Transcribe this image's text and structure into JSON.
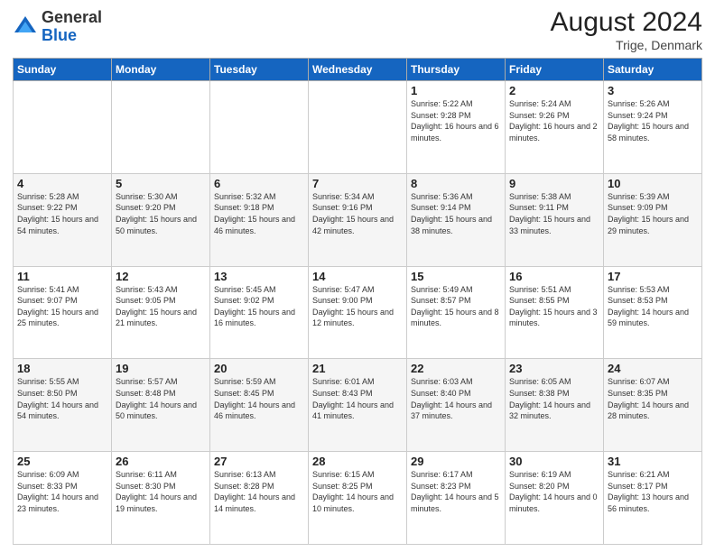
{
  "header": {
    "logo_general": "General",
    "logo_blue": "Blue",
    "month_year": "August 2024",
    "location": "Trige, Denmark"
  },
  "days_of_week": [
    "Sunday",
    "Monday",
    "Tuesday",
    "Wednesday",
    "Thursday",
    "Friday",
    "Saturday"
  ],
  "weeks": [
    [
      {
        "day": "",
        "info": ""
      },
      {
        "day": "",
        "info": ""
      },
      {
        "day": "",
        "info": ""
      },
      {
        "day": "",
        "info": ""
      },
      {
        "day": "1",
        "info": "Sunrise: 5:22 AM\nSunset: 9:28 PM\nDaylight: 16 hours\nand 6 minutes."
      },
      {
        "day": "2",
        "info": "Sunrise: 5:24 AM\nSunset: 9:26 PM\nDaylight: 16 hours\nand 2 minutes."
      },
      {
        "day": "3",
        "info": "Sunrise: 5:26 AM\nSunset: 9:24 PM\nDaylight: 15 hours\nand 58 minutes."
      }
    ],
    [
      {
        "day": "4",
        "info": "Sunrise: 5:28 AM\nSunset: 9:22 PM\nDaylight: 15 hours\nand 54 minutes."
      },
      {
        "day": "5",
        "info": "Sunrise: 5:30 AM\nSunset: 9:20 PM\nDaylight: 15 hours\nand 50 minutes."
      },
      {
        "day": "6",
        "info": "Sunrise: 5:32 AM\nSunset: 9:18 PM\nDaylight: 15 hours\nand 46 minutes."
      },
      {
        "day": "7",
        "info": "Sunrise: 5:34 AM\nSunset: 9:16 PM\nDaylight: 15 hours\nand 42 minutes."
      },
      {
        "day": "8",
        "info": "Sunrise: 5:36 AM\nSunset: 9:14 PM\nDaylight: 15 hours\nand 38 minutes."
      },
      {
        "day": "9",
        "info": "Sunrise: 5:38 AM\nSunset: 9:11 PM\nDaylight: 15 hours\nand 33 minutes."
      },
      {
        "day": "10",
        "info": "Sunrise: 5:39 AM\nSunset: 9:09 PM\nDaylight: 15 hours\nand 29 minutes."
      }
    ],
    [
      {
        "day": "11",
        "info": "Sunrise: 5:41 AM\nSunset: 9:07 PM\nDaylight: 15 hours\nand 25 minutes."
      },
      {
        "day": "12",
        "info": "Sunrise: 5:43 AM\nSunset: 9:05 PM\nDaylight: 15 hours\nand 21 minutes."
      },
      {
        "day": "13",
        "info": "Sunrise: 5:45 AM\nSunset: 9:02 PM\nDaylight: 15 hours\nand 16 minutes."
      },
      {
        "day": "14",
        "info": "Sunrise: 5:47 AM\nSunset: 9:00 PM\nDaylight: 15 hours\nand 12 minutes."
      },
      {
        "day": "15",
        "info": "Sunrise: 5:49 AM\nSunset: 8:57 PM\nDaylight: 15 hours\nand 8 minutes."
      },
      {
        "day": "16",
        "info": "Sunrise: 5:51 AM\nSunset: 8:55 PM\nDaylight: 15 hours\nand 3 minutes."
      },
      {
        "day": "17",
        "info": "Sunrise: 5:53 AM\nSunset: 8:53 PM\nDaylight: 14 hours\nand 59 minutes."
      }
    ],
    [
      {
        "day": "18",
        "info": "Sunrise: 5:55 AM\nSunset: 8:50 PM\nDaylight: 14 hours\nand 54 minutes."
      },
      {
        "day": "19",
        "info": "Sunrise: 5:57 AM\nSunset: 8:48 PM\nDaylight: 14 hours\nand 50 minutes."
      },
      {
        "day": "20",
        "info": "Sunrise: 5:59 AM\nSunset: 8:45 PM\nDaylight: 14 hours\nand 46 minutes."
      },
      {
        "day": "21",
        "info": "Sunrise: 6:01 AM\nSunset: 8:43 PM\nDaylight: 14 hours\nand 41 minutes."
      },
      {
        "day": "22",
        "info": "Sunrise: 6:03 AM\nSunset: 8:40 PM\nDaylight: 14 hours\nand 37 minutes."
      },
      {
        "day": "23",
        "info": "Sunrise: 6:05 AM\nSunset: 8:38 PM\nDaylight: 14 hours\nand 32 minutes."
      },
      {
        "day": "24",
        "info": "Sunrise: 6:07 AM\nSunset: 8:35 PM\nDaylight: 14 hours\nand 28 minutes."
      }
    ],
    [
      {
        "day": "25",
        "info": "Sunrise: 6:09 AM\nSunset: 8:33 PM\nDaylight: 14 hours\nand 23 minutes."
      },
      {
        "day": "26",
        "info": "Sunrise: 6:11 AM\nSunset: 8:30 PM\nDaylight: 14 hours\nand 19 minutes."
      },
      {
        "day": "27",
        "info": "Sunrise: 6:13 AM\nSunset: 8:28 PM\nDaylight: 14 hours\nand 14 minutes."
      },
      {
        "day": "28",
        "info": "Sunrise: 6:15 AM\nSunset: 8:25 PM\nDaylight: 14 hours\nand 10 minutes."
      },
      {
        "day": "29",
        "info": "Sunrise: 6:17 AM\nSunset: 8:23 PM\nDaylight: 14 hours\nand 5 minutes."
      },
      {
        "day": "30",
        "info": "Sunrise: 6:19 AM\nSunset: 8:20 PM\nDaylight: 14 hours\nand 0 minutes."
      },
      {
        "day": "31",
        "info": "Sunrise: 6:21 AM\nSunset: 8:17 PM\nDaylight: 13 hours\nand 56 minutes."
      }
    ]
  ]
}
